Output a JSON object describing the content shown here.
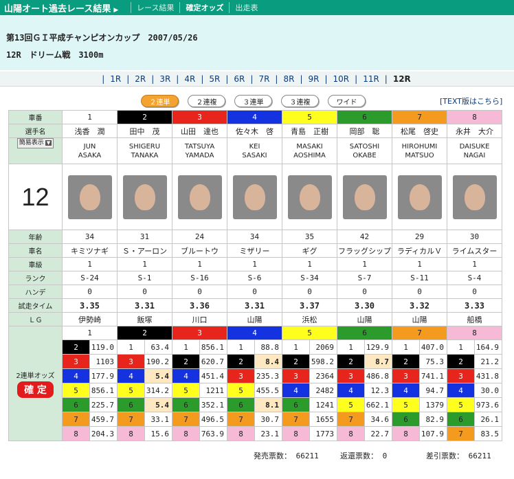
{
  "header": {
    "title": "山陽オート過去レース結果",
    "nav": [
      "レース結果",
      "確定オッズ",
      "出走表"
    ]
  },
  "race": {
    "name": "第13回ＧＩ平成チャンピオンカップ　2007/05/26",
    "sub": "12R　ドリーム戦　3100m"
  },
  "race_tabs": [
    "1R",
    "2R",
    "3R",
    "4R",
    "5R",
    "6R",
    "7R",
    "8R",
    "9R",
    "10R",
    "11R",
    "12R"
  ],
  "current_race": "12R",
  "odds_buttons": [
    "２連単",
    "２連複",
    "３連単",
    "３連複",
    "ワイド"
  ],
  "text_link": "[TEXT版はこちら]",
  "labels": {
    "car": "車番",
    "rider": "選手名",
    "display_select": "簡易表示",
    "age": "年齢",
    "machine": "車名",
    "class": "車級",
    "rank": "ランク",
    "handicap": "ハンデ",
    "trial": "試走タイム",
    "lg": "ＬＧ",
    "odds_side": "2連単オッズ",
    "confirmed": "確 定"
  },
  "race_number": "12",
  "colors": {
    "1": "#ffffff",
    "2": "#000000",
    "3": "#e8251c",
    "4": "#1532e0",
    "5": "#ffff1e",
    "6": "#2b9c2b",
    "7": "#f39a1f",
    "8": "#f6b9d6"
  },
  "riders": [
    {
      "car": "1",
      "name": "浅香　潤",
      "en1": "JUN",
      "en2": "ASAKA",
      "age": "34",
      "machine": "キミツナギ",
      "cls": "1",
      "rank": "S-24",
      "hande": "0",
      "time": "3.35",
      "lg": "伊勢崎"
    },
    {
      "car": "2",
      "name": "田中　茂",
      "en1": "SHIGERU",
      "en2": "TANAKA",
      "age": "31",
      "machine": "Ｓ・アーロン",
      "cls": "1",
      "rank": "S-1",
      "hande": "0",
      "time": "3.31",
      "lg": "飯塚"
    },
    {
      "car": "3",
      "name": "山田　達也",
      "en1": "TATSUYA",
      "en2": "YAMADA",
      "age": "24",
      "machine": "ブルートウ",
      "cls": "1",
      "rank": "S-16",
      "hande": "0",
      "time": "3.36",
      "lg": "川口"
    },
    {
      "car": "4",
      "name": "佐々木　啓",
      "en1": "KEI",
      "en2": "SASAKI",
      "age": "34",
      "machine": "ミザリー",
      "cls": "1",
      "rank": "S-6",
      "hande": "0",
      "time": "3.31",
      "lg": "山陽"
    },
    {
      "car": "5",
      "name": "青島　正樹",
      "en1": "MASAKI",
      "en2": "AOSHIMA",
      "age": "35",
      "machine": "ギグ",
      "cls": "1",
      "rank": "S-34",
      "hande": "0",
      "time": "3.37",
      "lg": "浜松"
    },
    {
      "car": "6",
      "name": "岡部　聡",
      "en1": "SATOSHI",
      "en2": "OKABE",
      "age": "42",
      "machine": "フラッグシップ",
      "cls": "1",
      "rank": "S-7",
      "hande": "0",
      "time": "3.30",
      "lg": "山陽"
    },
    {
      "car": "7",
      "name": "松尾　啓史",
      "en1": "HIROHUMI",
      "en2": "MATSUO",
      "age": "29",
      "machine": "ラディカルＶ",
      "cls": "1",
      "rank": "S-11",
      "hande": "0",
      "time": "3.32",
      "lg": "山陽"
    },
    {
      "car": "8",
      "name": "永井　大介",
      "en1": "DAISUKE",
      "en2": "NAGAI",
      "age": "30",
      "machine": "ライムスター",
      "cls": "1",
      "rank": "S-4",
      "hande": "0",
      "time": "3.33",
      "lg": "船橋"
    }
  ],
  "odds": {
    "1": [
      [
        "2",
        "119.0"
      ],
      [
        "3",
        "1103"
      ],
      [
        "4",
        "177.9"
      ],
      [
        "5",
        "856.1"
      ],
      [
        "6",
        "225.7"
      ],
      [
        "7",
        "459.7"
      ],
      [
        "8",
        "204.3"
      ]
    ],
    "2": [
      [
        "1",
        "63.4"
      ],
      [
        "3",
        "190.2"
      ],
      [
        "4",
        "5.4"
      ],
      [
        "5",
        "314.2"
      ],
      [
        "6",
        "5.4"
      ],
      [
        "7",
        "33.1"
      ],
      [
        "8",
        "15.6"
      ]
    ],
    "3": [
      [
        "1",
        "856.1"
      ],
      [
        "2",
        "620.7"
      ],
      [
        "4",
        "451.4"
      ],
      [
        "5",
        "1211"
      ],
      [
        "6",
        "352.1"
      ],
      [
        "7",
        "496.5"
      ],
      [
        "8",
        "763.9"
      ]
    ],
    "4": [
      [
        "1",
        "88.8"
      ],
      [
        "2",
        "8.4"
      ],
      [
        "3",
        "235.3"
      ],
      [
        "5",
        "455.5"
      ],
      [
        "6",
        "8.1"
      ],
      [
        "7",
        "30.7"
      ],
      [
        "8",
        "23.1"
      ]
    ],
    "5": [
      [
        "1",
        "2069"
      ],
      [
        "2",
        "598.2"
      ],
      [
        "3",
        "2364"
      ],
      [
        "4",
        "2482"
      ],
      [
        "6",
        "1241"
      ],
      [
        "7",
        "1655"
      ],
      [
        "8",
        "1773"
      ]
    ],
    "6": [
      [
        "1",
        "129.9"
      ],
      [
        "2",
        "8.7"
      ],
      [
        "3",
        "486.8"
      ],
      [
        "4",
        "12.3"
      ],
      [
        "5",
        "662.1"
      ],
      [
        "7",
        "34.6"
      ],
      [
        "8",
        "22.7"
      ]
    ],
    "7": [
      [
        "1",
        "407.0"
      ],
      [
        "2",
        "75.3"
      ],
      [
        "3",
        "741.1"
      ],
      [
        "4",
        "94.7"
      ],
      [
        "5",
        "1379"
      ],
      [
        "6",
        "82.9"
      ],
      [
        "8",
        "107.9"
      ]
    ],
    "8": [
      [
        "1",
        "164.9"
      ],
      [
        "2",
        "21.2"
      ],
      [
        "3",
        "431.8"
      ],
      [
        "4",
        "30.0"
      ],
      [
        "5",
        "973.6"
      ],
      [
        "6",
        "26.1"
      ],
      [
        "7",
        "83.5"
      ]
    ]
  },
  "highlight": [
    "2-4",
    "2-6",
    "4-2",
    "4-6",
    "6-2"
  ],
  "footer": {
    "sales": "発売票数： 66211",
    "refund": "返還票数： 0",
    "net": "差引票数： 66211"
  }
}
